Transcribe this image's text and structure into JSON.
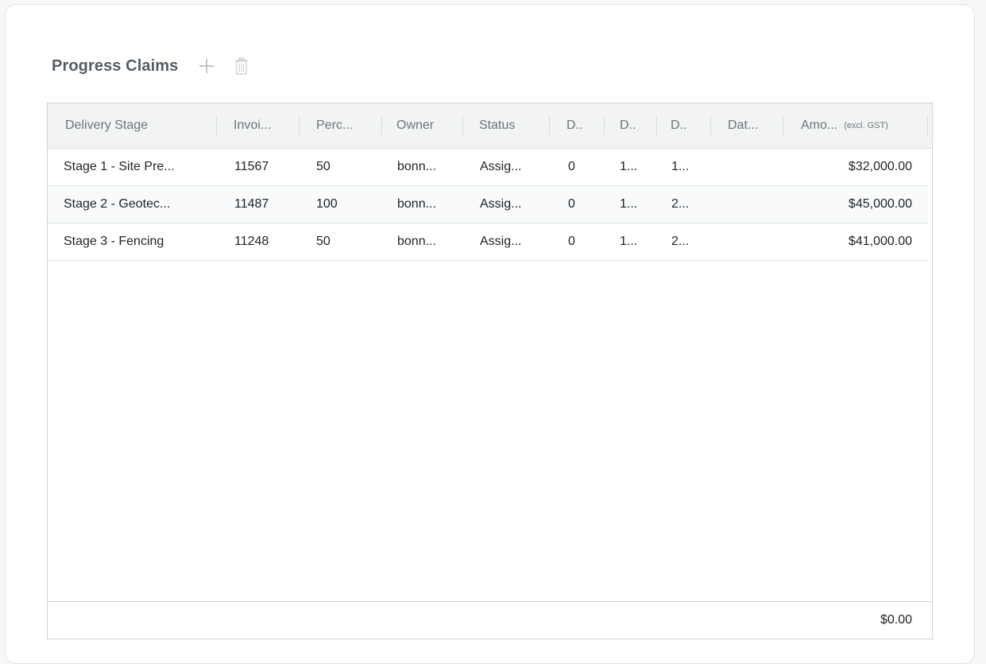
{
  "panel": {
    "title": "Progress Claims",
    "add_icon": "plus-icon",
    "delete_icon": "trash-icon"
  },
  "table": {
    "columns": [
      {
        "label": "Delivery Stage",
        "sub": ""
      },
      {
        "label": "Invoi...",
        "sub": ""
      },
      {
        "label": "Perc...",
        "sub": ""
      },
      {
        "label": "Owner",
        "sub": ""
      },
      {
        "label": "Status",
        "sub": ""
      },
      {
        "label": "D..",
        "sub": ""
      },
      {
        "label": "D..",
        "sub": ""
      },
      {
        "label": "D..",
        "sub": ""
      },
      {
        "label": "Dat...",
        "sub": ""
      },
      {
        "label": "Amo...",
        "sub": "(excl. GST)"
      }
    ],
    "rows": [
      {
        "stage": "Stage 1 - Site Pre...",
        "invoice": "11567",
        "percent": "50",
        "owner": "bonn...",
        "status": "Assig...",
        "d1": "0",
        "d2": "1...",
        "d3": "1...",
        "date": "",
        "amount": "$32,000.00"
      },
      {
        "stage": "Stage 2 - Geotec...",
        "invoice": "11487",
        "percent": "100",
        "owner": "bonn...",
        "status": "Assig...",
        "d1": "0",
        "d2": "1...",
        "d3": "2...",
        "date": "",
        "amount": "$45,000.00"
      },
      {
        "stage": "Stage 3 - Fencing",
        "invoice": "11248",
        "percent": "50",
        "owner": "bonn...",
        "status": "Assig...",
        "d1": "0",
        "d2": "1...",
        "d3": "2...",
        "date": "",
        "amount": "$41,000.00"
      }
    ],
    "footer_total": "$0.00"
  },
  "colors": {
    "title": "#545c65",
    "header_bg": "#f2f4f4",
    "border": "#cfd3d3",
    "icon": "#aab2b8"
  }
}
